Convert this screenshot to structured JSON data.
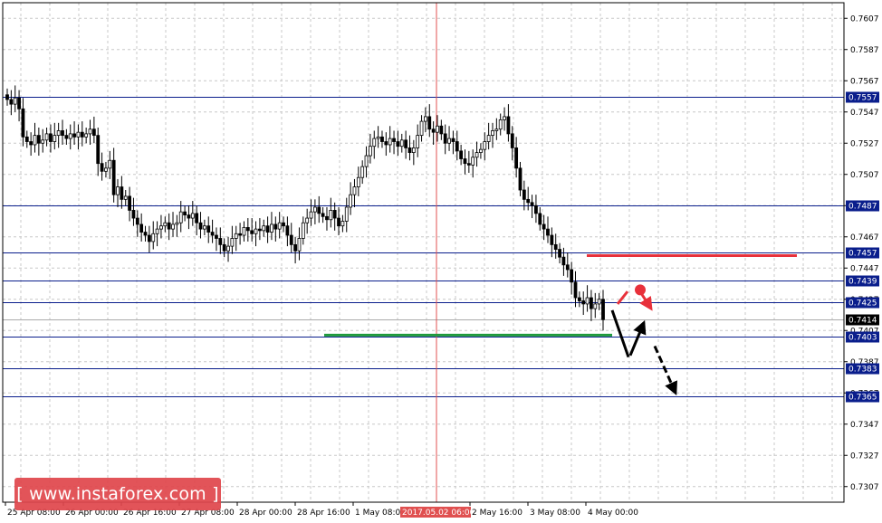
{
  "chart_data": {
    "type": "candlestick",
    "instrument": "",
    "y_axis": {
      "min": 0.7297,
      "max": 0.7617,
      "ticks": [
        "0.7607",
        "0.7587",
        "0.7567",
        "0.7547",
        "0.7527",
        "0.7507",
        "0.7487",
        "0.7467",
        "0.7447",
        "0.7427",
        "0.7407",
        "0.7387",
        "0.7367",
        "0.7347",
        "0.7327",
        "0.7307"
      ],
      "position": "right"
    },
    "x_axis": {
      "labels": [
        "25 Apr 08:00",
        "26 Apr 00:00",
        "26 Apr 16:00",
        "27 Apr 08:00",
        "28 Apr 00:00",
        "28 Apr 16:00",
        "1 May 08:00",
        "2017.05.02 06:00",
        "2 May 16:00",
        "3 May 08:00",
        "4 May 00:00"
      ],
      "highlighted_label": "2017.05.02 06:00"
    },
    "grid": true,
    "current_price": "0.7414",
    "levels": [
      {
        "value": 0.7557,
        "label": "0.7557"
      },
      {
        "value": 0.7487,
        "label": "0.7487"
      },
      {
        "value": 0.7457,
        "label": "0.7457"
      },
      {
        "value": 0.7439,
        "label": "0.7439"
      },
      {
        "value": 0.7425,
        "label": "0.7425"
      },
      {
        "value": 0.7403,
        "label": "0.7403"
      },
      {
        "value": 0.7383,
        "label": "0.7383"
      },
      {
        "value": 0.7365,
        "label": "0.7365"
      }
    ],
    "resistance_line": {
      "value": 0.7455,
      "color": "#e8313b"
    },
    "support_line": {
      "value": 0.7404,
      "color": "#1f9a3c"
    },
    "close_series": [
      0.7555,
      0.7552,
      0.7556,
      0.7549,
      0.7531,
      0.7528,
      0.7526,
      0.7532,
      0.7527,
      0.7529,
      0.7533,
      0.7528,
      0.7532,
      0.7535,
      0.7532,
      0.753,
      0.7533,
      0.7531,
      0.7534,
      0.7531,
      0.7533,
      0.7536,
      0.7532,
      0.7514,
      0.7509,
      0.7511,
      0.7516,
      0.7494,
      0.7499,
      0.7491,
      0.7493,
      0.7484,
      0.7479,
      0.7475,
      0.747,
      0.7468,
      0.7464,
      0.7469,
      0.7472,
      0.7474,
      0.7476,
      0.7472,
      0.7475,
      0.7476,
      0.7483,
      0.7481,
      0.7479,
      0.7482,
      0.7476,
      0.7472,
      0.7474,
      0.747,
      0.7468,
      0.7466,
      0.7462,
      0.7458,
      0.7461,
      0.7466,
      0.7469,
      0.7468,
      0.7473,
      0.7471,
      0.7469,
      0.7472,
      0.7471,
      0.7474,
      0.747,
      0.7475,
      0.7472,
      0.7476,
      0.7474,
      0.7468,
      0.7462,
      0.7458,
      0.7466,
      0.7476,
      0.7479,
      0.7483,
      0.7486,
      0.7482,
      0.748,
      0.7478,
      0.7484,
      0.7479,
      0.7474,
      0.7477,
      0.7486,
      0.7494,
      0.7499,
      0.7505,
      0.7512,
      0.7519,
      0.7525,
      0.753,
      0.7531,
      0.7528,
      0.7526,
      0.753,
      0.7528,
      0.7525,
      0.7529,
      0.7524,
      0.7521,
      0.7524,
      0.7532,
      0.7541,
      0.7544,
      0.7536,
      0.7534,
      0.7538,
      0.7533,
      0.7527,
      0.753,
      0.7528,
      0.7522,
      0.7517,
      0.7514,
      0.7513,
      0.7518,
      0.7521,
      0.7523,
      0.7528,
      0.7532,
      0.7535,
      0.7536,
      0.7542,
      0.7544,
      0.7533,
      0.7524,
      0.7511,
      0.7497,
      0.7491,
      0.7489,
      0.7487,
      0.7482,
      0.7475,
      0.7472,
      0.7468,
      0.7462,
      0.7459,
      0.7454,
      0.7449,
      0.7446,
      0.7438,
      0.7428,
      0.7426,
      0.7424,
      0.7428,
      0.7421,
      0.7424,
      0.7427,
      0.7414
    ],
    "colors": {
      "grid": "#c8c8c8",
      "level_line": "#0a1e8c",
      "vline": "#e05050",
      "up_candle": "#ffffff",
      "down_candle": "#000000",
      "arrow_red": "#e8313b",
      "arrow_black": "#000000"
    }
  },
  "watermark": {
    "text": "[ www.instaforex.com ]"
  }
}
